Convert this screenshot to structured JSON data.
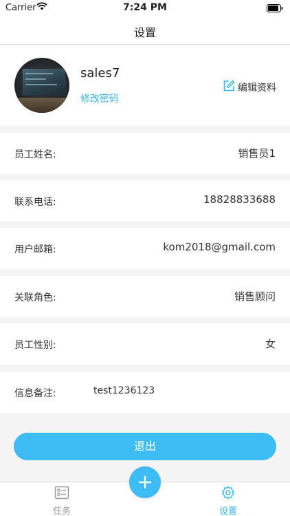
{
  "status_bar": {
    "carrier": "Carrier",
    "time": "7:24 PM"
  },
  "nav": {
    "title": "设置"
  },
  "profile": {
    "username": "sales7",
    "change_password": "修改密码",
    "edit_profile": "编辑资料"
  },
  "info_rows": [
    {
      "label": "员工姓名:",
      "value": "销售员1"
    },
    {
      "label": "联系电话:",
      "value": "18828833688"
    },
    {
      "label": "用户邮箱:",
      "value": "kom2018@gmail.com"
    },
    {
      "label": "关联角色:",
      "value": "销售顾问"
    },
    {
      "label": "员工性别:",
      "value": "女"
    },
    {
      "label": "信息备注:",
      "value": "test1236123"
    }
  ],
  "logout_label": "退出",
  "tabs": [
    {
      "label": "任务",
      "icon": "task-list-icon",
      "active": false
    },
    {
      "label": "设置",
      "icon": "gear-icon",
      "active": true
    }
  ],
  "colors": {
    "accent": "#3dbcf4",
    "link": "#38b6ef",
    "background": "#f4f4f4"
  }
}
